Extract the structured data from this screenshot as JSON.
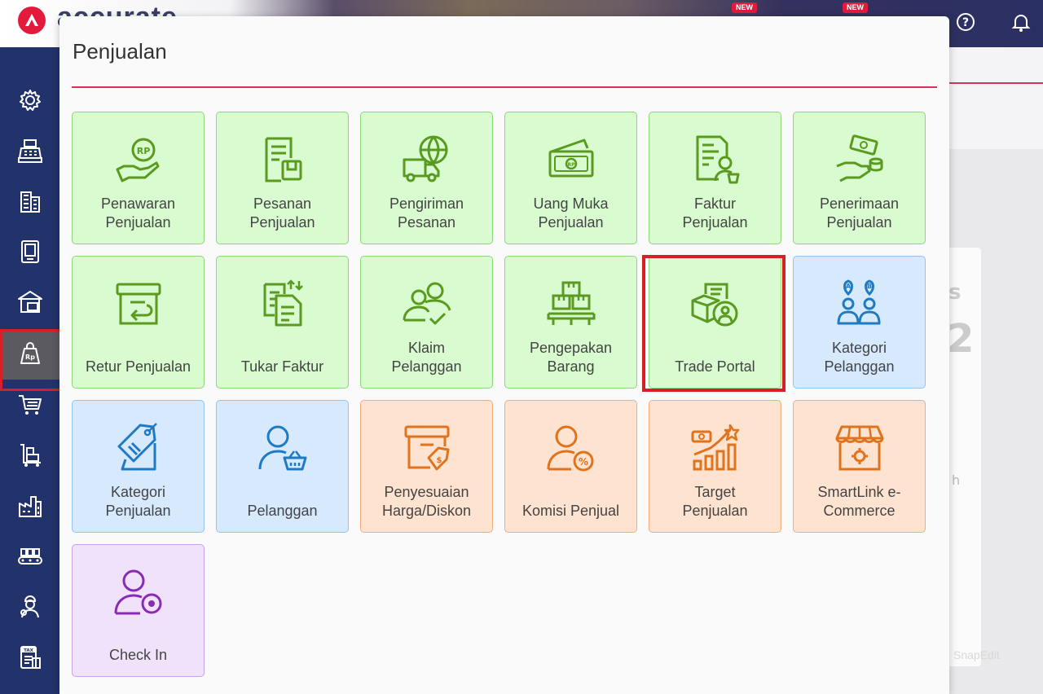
{
  "app": {
    "logo_text": "accurate",
    "badge_new": "NEW"
  },
  "modal": {
    "title": "Penjualan"
  },
  "tiles": [
    {
      "label": "Penawaran\nPenjualan",
      "icon": "hand-money-icon",
      "color": "green"
    },
    {
      "label": "Pesanan\nPenjualan",
      "icon": "order-document-icon",
      "color": "green"
    },
    {
      "label": "Pengiriman\nPesanan",
      "icon": "delivery-truck-icon",
      "color": "green"
    },
    {
      "label": "Uang Muka\nPenjualan",
      "icon": "banknote-icon",
      "color": "green"
    },
    {
      "label": "Faktur\nPenjualan",
      "icon": "invoice-icon",
      "color": "green"
    },
    {
      "label": "Penerimaan\nPenjualan",
      "icon": "payment-receive-icon",
      "color": "green"
    },
    {
      "label": "Retur Penjualan",
      "icon": "return-box-icon",
      "color": "green"
    },
    {
      "label": "Tukar Faktur",
      "icon": "exchange-invoice-icon",
      "color": "green"
    },
    {
      "label": "Klaim\nPelanggan",
      "icon": "customer-claim-icon",
      "color": "green"
    },
    {
      "label": "Pengepakan\nBarang",
      "icon": "packing-boxes-icon",
      "color": "green"
    },
    {
      "label": "Trade Portal",
      "icon": "trade-portal-icon",
      "color": "green"
    },
    {
      "label": "Kategori\nPelanggan",
      "icon": "customer-category-icon",
      "color": "blue"
    },
    {
      "label": "Kategori\nPenjualan",
      "icon": "tag-category-icon",
      "color": "blue"
    },
    {
      "label": "Pelanggan",
      "icon": "customer-basket-icon",
      "color": "blue"
    },
    {
      "label": "Penyesuaian\nHarga/Diskon",
      "icon": "price-adjust-icon",
      "color": "orange"
    },
    {
      "label": "Komisi Penjual",
      "icon": "commission-icon",
      "color": "orange"
    },
    {
      "label": "Target\nPenjualan",
      "icon": "sales-target-icon",
      "color": "orange"
    },
    {
      "label": "SmartLink e-\nCommerce",
      "icon": "store-icon",
      "color": "orange"
    },
    {
      "label": "Check In",
      "icon": "user-location-icon",
      "color": "purple"
    }
  ],
  "sidebar": [
    "gear-icon",
    "cash-register-icon",
    "building-icon",
    "ledger-icon",
    "warehouse-icon",
    "sales-bag-icon",
    "cart-icon",
    "trolley-icon",
    "factory-icon",
    "conveyor-icon",
    "worker-icon",
    "tax-document-icon"
  ],
  "colors": {
    "green": "#5a9a1e",
    "blue": "#1f7ac4",
    "orange": "#e0731c",
    "purple": "#8a2bb5",
    "highlight": "#d61f26"
  },
  "watermark": "SnapEdit",
  "background_letters": {
    "s": "s",
    "two": "2",
    "h": "h"
  }
}
